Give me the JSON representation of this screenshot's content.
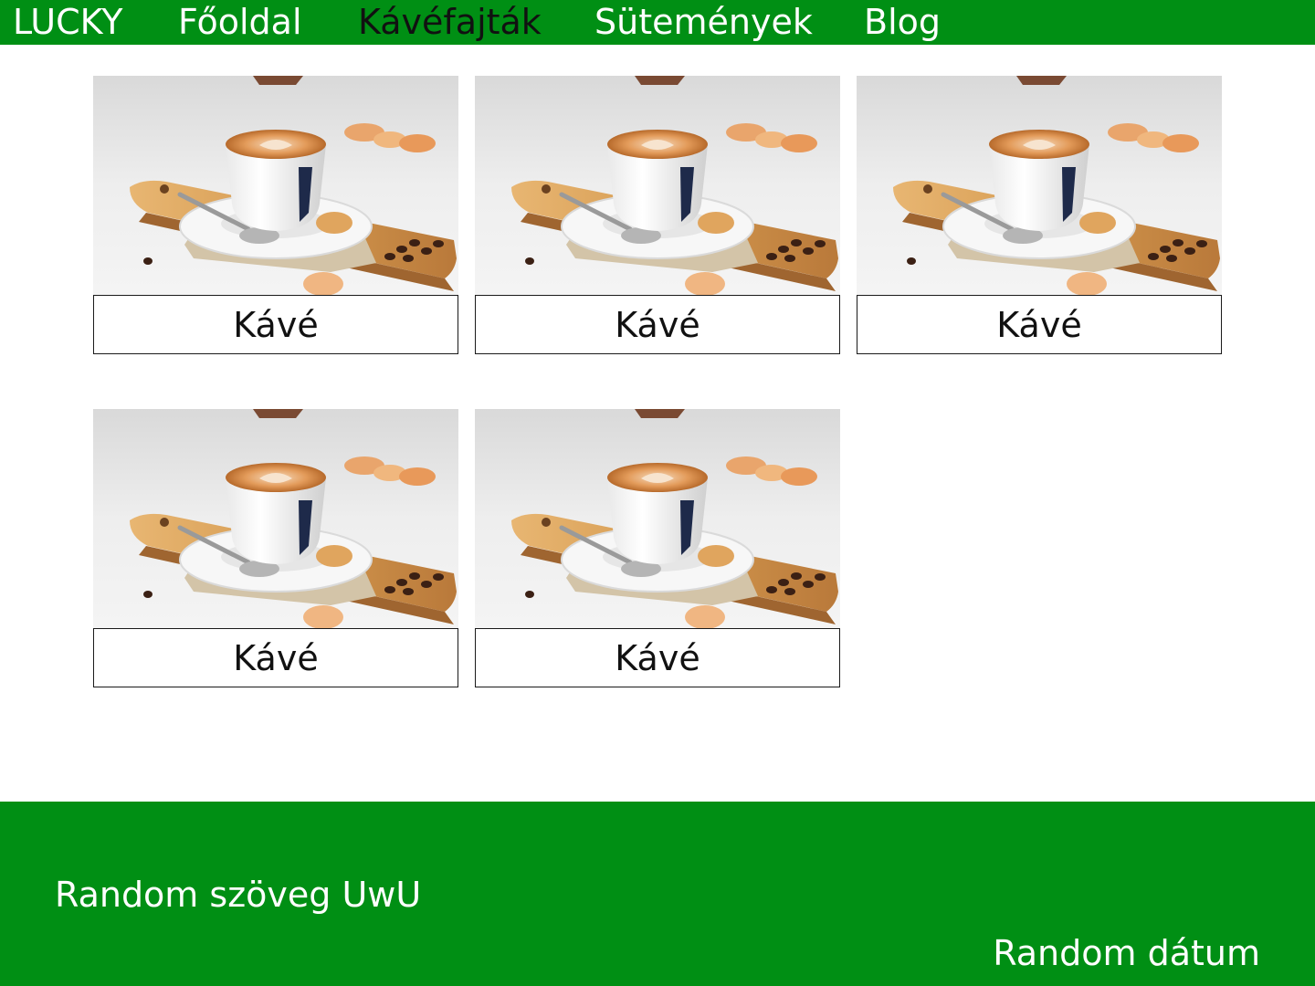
{
  "nav": {
    "logo": "LUCKY",
    "items": [
      {
        "label": "Főoldal",
        "active": false
      },
      {
        "label": "Kávéfajták",
        "active": true
      },
      {
        "label": "Sütemények",
        "active": false
      },
      {
        "label": "Blog",
        "active": false
      }
    ]
  },
  "products": [
    {
      "label": "Kávé",
      "image": "latte-cup-photo"
    },
    {
      "label": "Kávé",
      "image": "latte-cup-photo"
    },
    {
      "label": "Kávé",
      "image": "latte-cup-photo"
    },
    {
      "label": "Kávé",
      "image": "latte-cup-photo"
    },
    {
      "label": "Kávé",
      "image": "latte-cup-photo"
    }
  ],
  "footer": {
    "text": "Random szöveg UwU",
    "date": "Random dátum"
  },
  "colors": {
    "brand_green": "#008f14",
    "active_nav_text": "#111111",
    "nav_text": "#ffffff"
  }
}
